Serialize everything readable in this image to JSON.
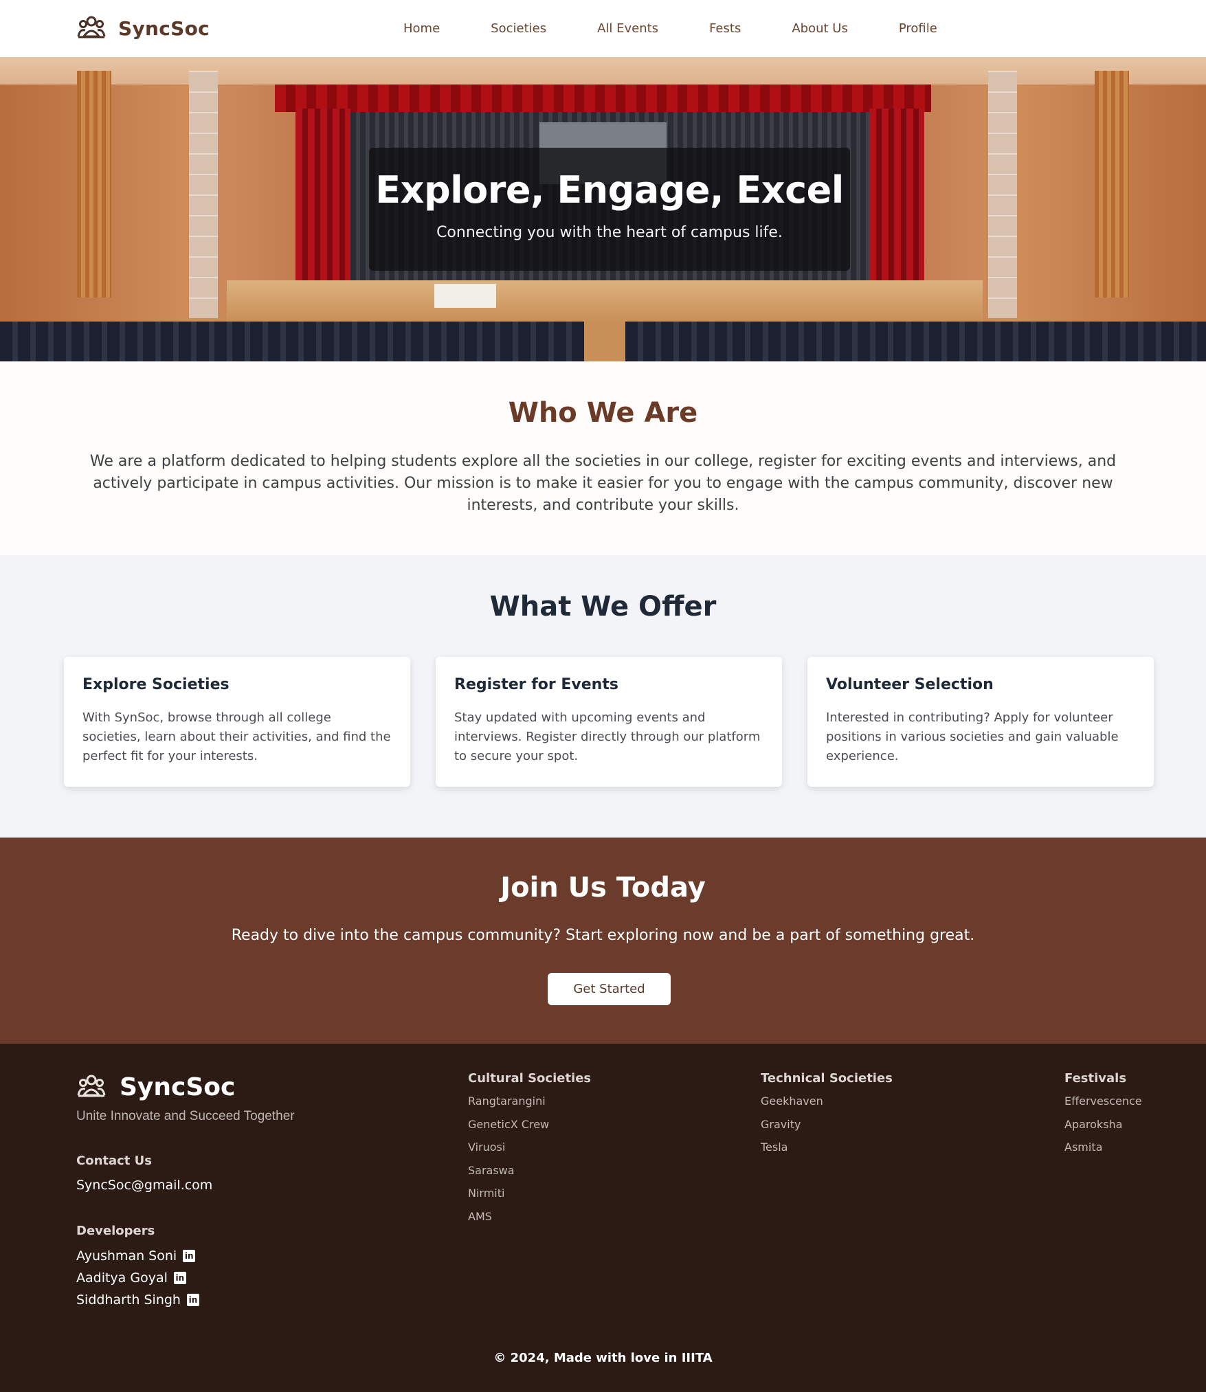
{
  "nav": {
    "brand": "SyncSoc",
    "links": [
      "Home",
      "Societies",
      "All Events",
      "Fests",
      "About Us",
      "Profile"
    ]
  },
  "hero": {
    "title": "Explore, Engage, Excel",
    "subtitle": "Connecting you with the heart of campus life."
  },
  "who": {
    "heading": "Who We Are",
    "text": "We are a platform dedicated to helping students explore all the societies in our college, register for exciting events and interviews, and actively participate in campus activities. Our mission is to make it easier for you to engage with the campus community, discover new interests, and contribute your skills."
  },
  "offer": {
    "heading": "What We Offer",
    "cards": [
      {
        "title": "Explore Societies",
        "text": "With SynSoc, browse through all college societies, learn about their activities, and find the perfect fit for your interests."
      },
      {
        "title": "Register for Events",
        "text": "Stay updated with upcoming events and interviews. Register directly through our platform to secure your spot."
      },
      {
        "title": "Volunteer Selection",
        "text": "Interested in contributing? Apply for volunteer positions in various societies and gain valuable experience."
      }
    ]
  },
  "join": {
    "heading": "Join Us Today",
    "text": "Ready to dive into the campus community? Start exploring now and be a part of something great.",
    "button": "Get Started"
  },
  "footer": {
    "brand": "SyncSoc",
    "tagline": "Unite Innovate and Succeed Together",
    "contact_label": "Contact Us",
    "email": "SyncSoc@gmail.com",
    "developers_label": "Developers",
    "developers": [
      "Ayushman Soni",
      "Aaditya Goyal",
      "Siddharth Singh"
    ],
    "columns": [
      {
        "title": "Cultural Societies",
        "items": [
          "Rangtarangini",
          "GeneticX Crew",
          "Viruosi",
          "Saraswa",
          "Nirmiti",
          "AMS"
        ]
      },
      {
        "title": "Technical Societies",
        "items": [
          "Geekhaven",
          "Gravity",
          "Tesla"
        ]
      },
      {
        "title": "Festivals",
        "items": [
          "Effervescence",
          "Aparoksha",
          "Asmita"
        ]
      }
    ],
    "copyright": "© 2024, Made with love in IIITA"
  },
  "colors": {
    "brand_brown": "#6b3b2c",
    "footer_bg": "#2c1a14",
    "offer_bg": "#f2f4f7"
  }
}
